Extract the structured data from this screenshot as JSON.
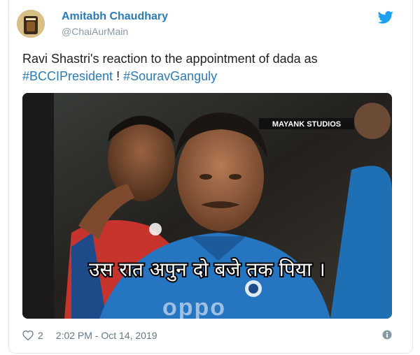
{
  "author": {
    "name": "Amitabh Chaudhary",
    "handle": "@ChaiAurMain"
  },
  "tweet": {
    "text": "Ravi Shastri's reaction to the appointment of dada as",
    "hashtag1": "#BCCIPresident",
    "separator": " ! ",
    "hashtag2": "#SouravGanguly"
  },
  "media": {
    "watermark": "MAYANK STUDIOS",
    "caption": "उस रात अपुन दो बजे तक पिया ।",
    "jersey_logo": "oppo"
  },
  "footer": {
    "likes": "2",
    "timestamp": "2:02 PM - Oct 14, 2019"
  },
  "colors": {
    "link": "#2b7bb9",
    "twitter_blue": "#1da1f2",
    "jersey_blue": "#1f6fb5"
  },
  "icons": {
    "brand": "twitter-bird-icon",
    "like": "heart-icon",
    "info": "info-icon"
  }
}
